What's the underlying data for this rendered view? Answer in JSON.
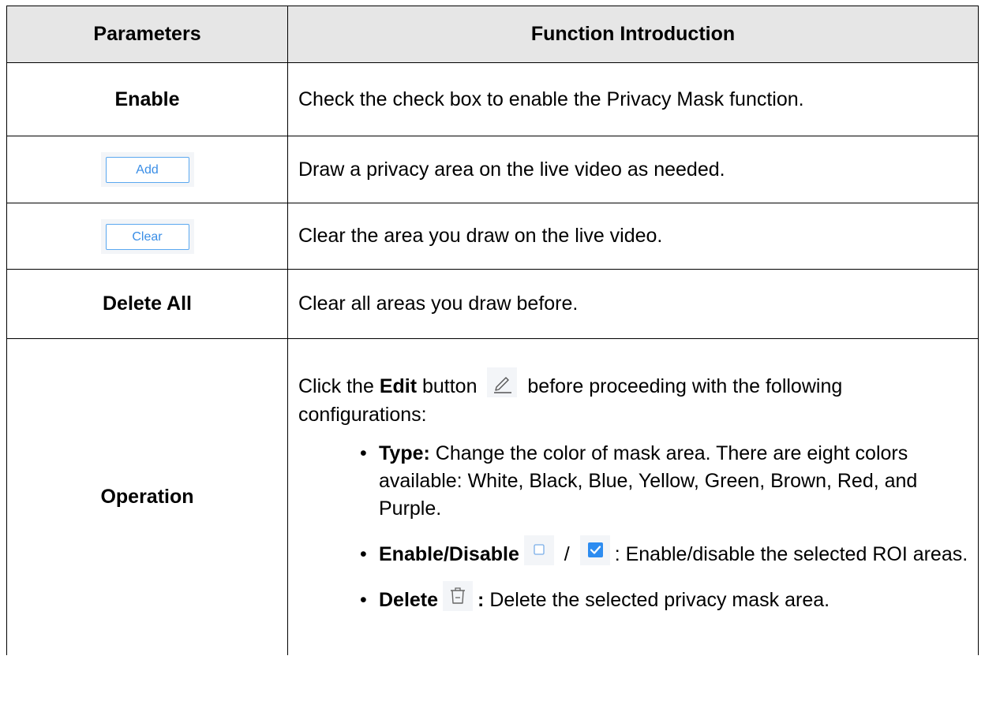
{
  "table": {
    "header": {
      "parameters": "Parameters",
      "function": "Function Introduction"
    },
    "rows": [
      {
        "param": "Enable",
        "desc": "Check the check box to enable the Privacy Mask function."
      },
      {
        "param_button": "Add",
        "desc": "Draw a privacy area on the live video as needed."
      },
      {
        "param_button": "Clear",
        "desc": "Clear the area you draw on the live video."
      },
      {
        "param": "Delete All",
        "desc": "Clear all areas you draw before."
      }
    ],
    "operation": {
      "param": "Operation",
      "intro_pre": "Click the ",
      "intro_bold": "Edit",
      "intro_mid": " button ",
      "intro_post": " before proceeding with the following configurations:",
      "edit_icon": "pencil-icon",
      "items": [
        {
          "bold": "Type:",
          "text": " Change the color of mask area. There are eight colors available: White, Black, Blue, Yellow, Green, Brown, Red, and Purple."
        },
        {
          "bold": "Enable/Disable",
          "sep": " / ",
          "text": ": Enable/disable the selected ROI areas.",
          "icons": [
            "unchecked-checkbox-icon",
            "checked-checkbox-icon"
          ]
        },
        {
          "bold": "Delete",
          "bold_after": ":",
          "text": " Delete the selected privacy mask area.",
          "icons": [
            "trash-icon"
          ]
        }
      ]
    }
  },
  "colors": {
    "header_bg": "#e6e6e6",
    "button_border": "#5aa8f0",
    "button_text": "#3a8ee6",
    "checkbox_checked": "#2d8cf0"
  }
}
